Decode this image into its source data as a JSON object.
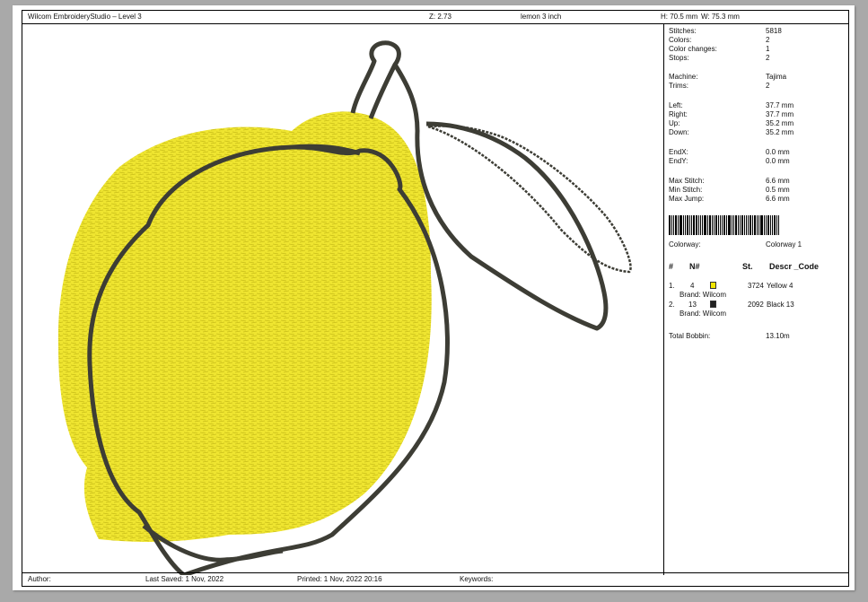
{
  "header": {
    "app_title": "Wilcom EmbroideryStudio – Level 3",
    "zoom": "Z: 2.73",
    "design_name": "lemon 3 inch",
    "height": "H: 70.5 mm",
    "width": "W: 75.3 mm"
  },
  "stats": [
    {
      "label": "Stitches:",
      "value": "5818"
    },
    {
      "label": "Colors:",
      "value": "2"
    },
    {
      "label": "Color changes:",
      "value": "1"
    },
    {
      "label": "Stops:",
      "value": "2"
    },
    {
      "label": "Machine:",
      "value": "Tajima"
    },
    {
      "label": "Trims:",
      "value": "2"
    },
    {
      "label": "Left:",
      "value": "37.7 mm"
    },
    {
      "label": "Right:",
      "value": "37.7 mm"
    },
    {
      "label": "Up:",
      "value": "35.2 mm"
    },
    {
      "label": "Down:",
      "value": "35.2 mm"
    },
    {
      "label": "EndX:",
      "value": "0.0 mm"
    },
    {
      "label": "EndY:",
      "value": "0.0 mm"
    },
    {
      "label": "Max Stitch:",
      "value": "6.6 mm"
    },
    {
      "label": "Min Stitch:",
      "value": "0.5 mm"
    },
    {
      "label": "Max Jump:",
      "value": "6.6 mm"
    }
  ],
  "colorway": {
    "label": "Colorway:",
    "value": "Colorway 1"
  },
  "color_table": {
    "headers": {
      "num": "#",
      "n": "N#",
      "st": "St.",
      "descr": "Descr _Code"
    },
    "rows": [
      {
        "num": "1.",
        "n": "4",
        "swatch": "#f2e600",
        "st": "3724",
        "descr": "Yellow 4",
        "brand": "Brand: Wilcom"
      },
      {
        "num": "2.",
        "n": "13",
        "swatch": "#222222",
        "st": "2092",
        "descr": "Black 13",
        "brand": "Brand: Wilcom"
      }
    ],
    "bobbin_label": "Total Bobbin:",
    "bobbin_value": "13.10m"
  },
  "footer": {
    "author": "Author:",
    "last_saved": "Last Saved:  1 Nov, 2022",
    "printed": "Printed:  1 Nov, 2022 20:16",
    "keywords": "Keywords:"
  },
  "colors": {
    "lemon_fill": "#f2e93a",
    "outline": "#3d3d35"
  }
}
